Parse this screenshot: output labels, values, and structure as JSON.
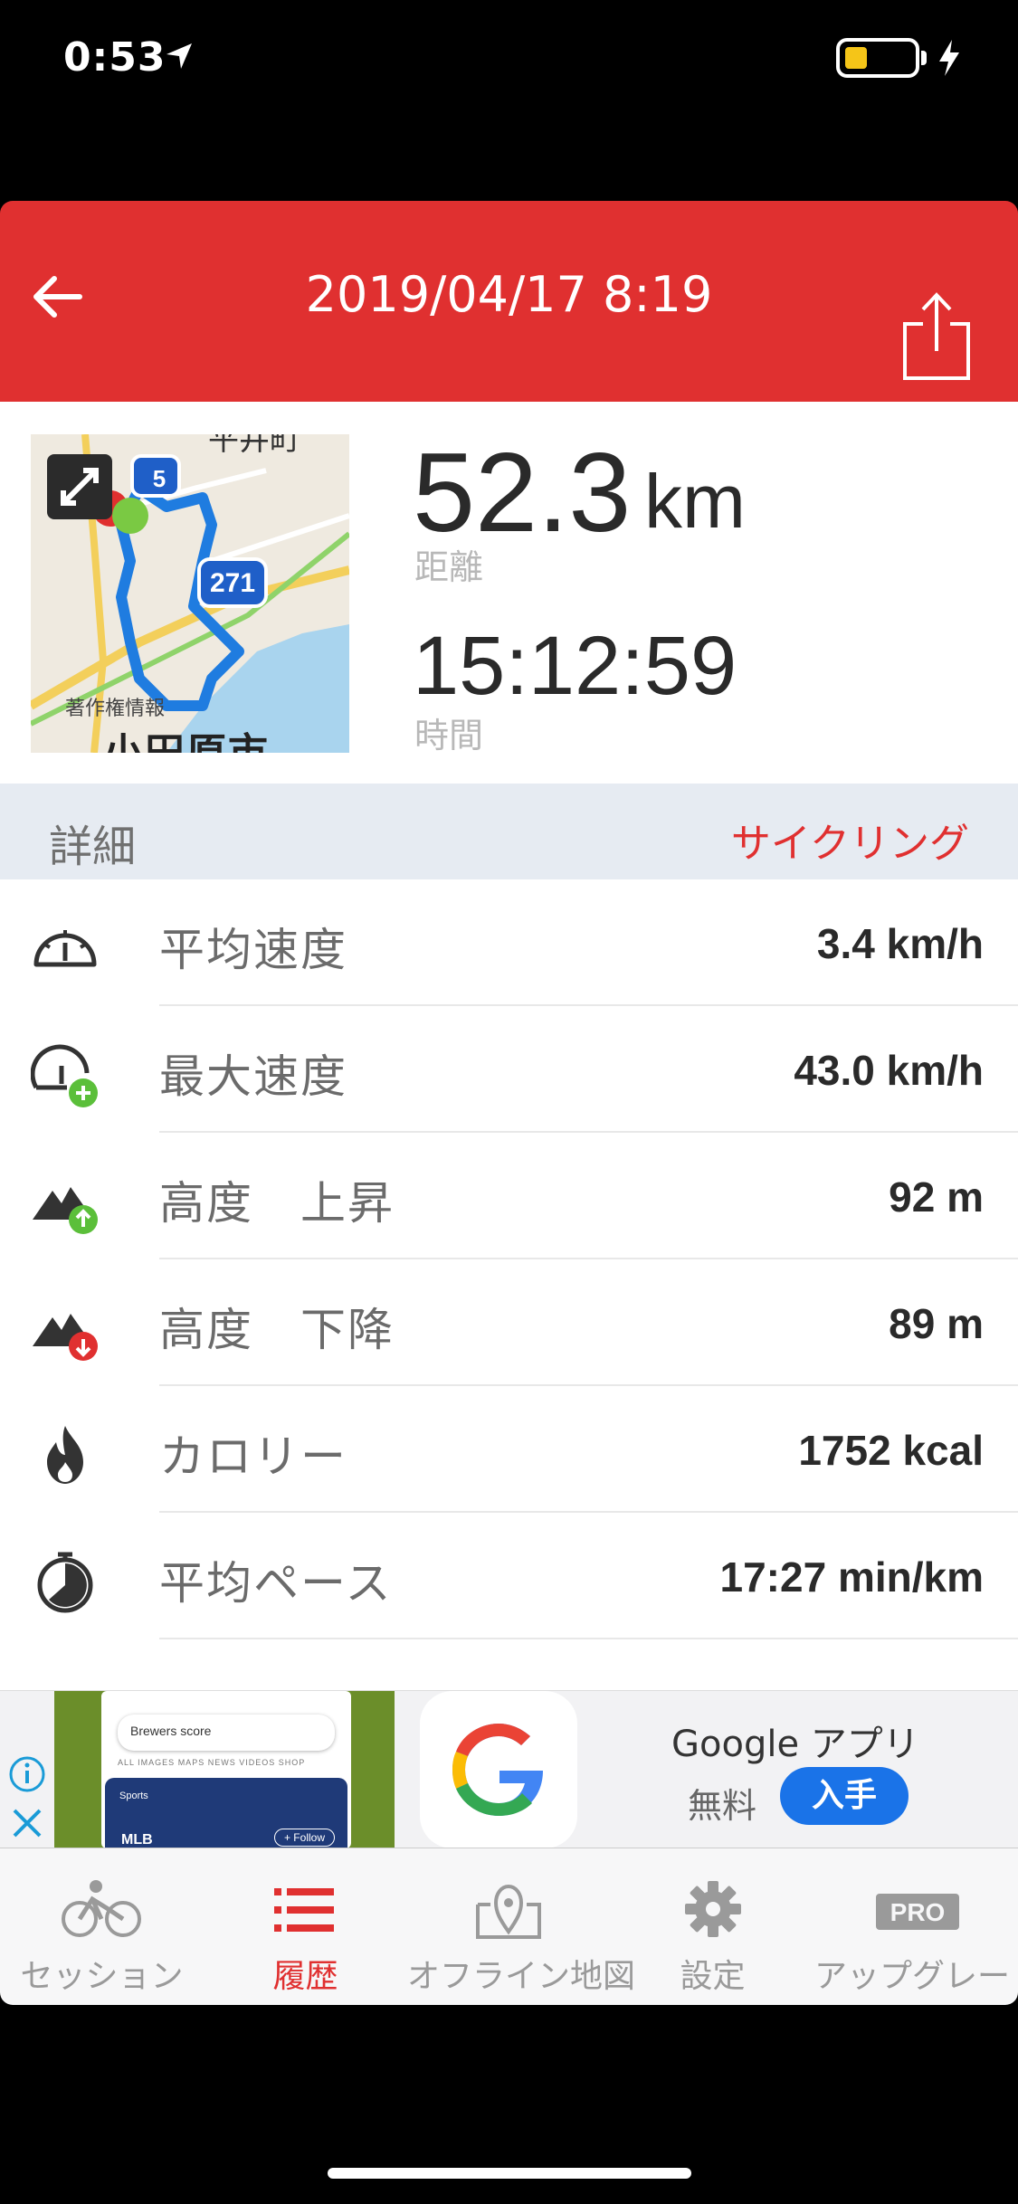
{
  "status_bar": {
    "time": "0:53",
    "battery_color": "#f5c518"
  },
  "header": {
    "title": "2019/04/17 8:19",
    "back_icon": "arrow-left-icon",
    "share_icon": "share-icon",
    "accent_color": "#e03030"
  },
  "summary": {
    "map": {
      "attribution": "著作権情報",
      "city": "小田原市",
      "town": "平井町",
      "route_shield": "271",
      "route_shield_2": "5"
    },
    "distance_value": "52.3",
    "distance_unit": "km",
    "distance_label": "距離",
    "time_value": "15:12:59",
    "time_label": "時間"
  },
  "details": {
    "title": "詳細",
    "activity_type": "サイクリング",
    "rows": [
      {
        "icon": "speedometer-icon",
        "label": "平均速度",
        "value": "3.4 km/h"
      },
      {
        "icon": "speedometer-plus-icon",
        "label": "最大速度",
        "value": "43.0 km/h"
      },
      {
        "icon": "mountain-up-icon",
        "label": "高度　上昇",
        "value": "92 m"
      },
      {
        "icon": "mountain-down-icon",
        "label": "高度　下降",
        "value": "89 m"
      },
      {
        "icon": "flame-icon",
        "label": "カロリー",
        "value": "1752 kcal"
      },
      {
        "icon": "stopwatch-icon",
        "label": "平均ペース",
        "value": "17:27 min/km"
      }
    ]
  },
  "ad": {
    "search_query": "Brewers score",
    "search_tabs": "ALL   IMAGES   MAPS   NEWS   VIDEOS   SHOP",
    "card_category": "Sports",
    "card_title": "MLB",
    "card_follow": "+ Follow",
    "app_name": "Google アプリ",
    "price": "無料",
    "get_label": "入手"
  },
  "tabbar": {
    "items": [
      {
        "icon": "cyclist-icon",
        "label": "セッション",
        "active": false
      },
      {
        "icon": "list-icon",
        "label": "履歴",
        "active": true
      },
      {
        "icon": "map-pin-icon",
        "label": "オフライン地図",
        "active": false
      },
      {
        "icon": "gear-icon",
        "label": "設定",
        "active": false
      },
      {
        "icon": "pro-badge-icon",
        "label": "アップグレード",
        "active": false
      }
    ]
  }
}
